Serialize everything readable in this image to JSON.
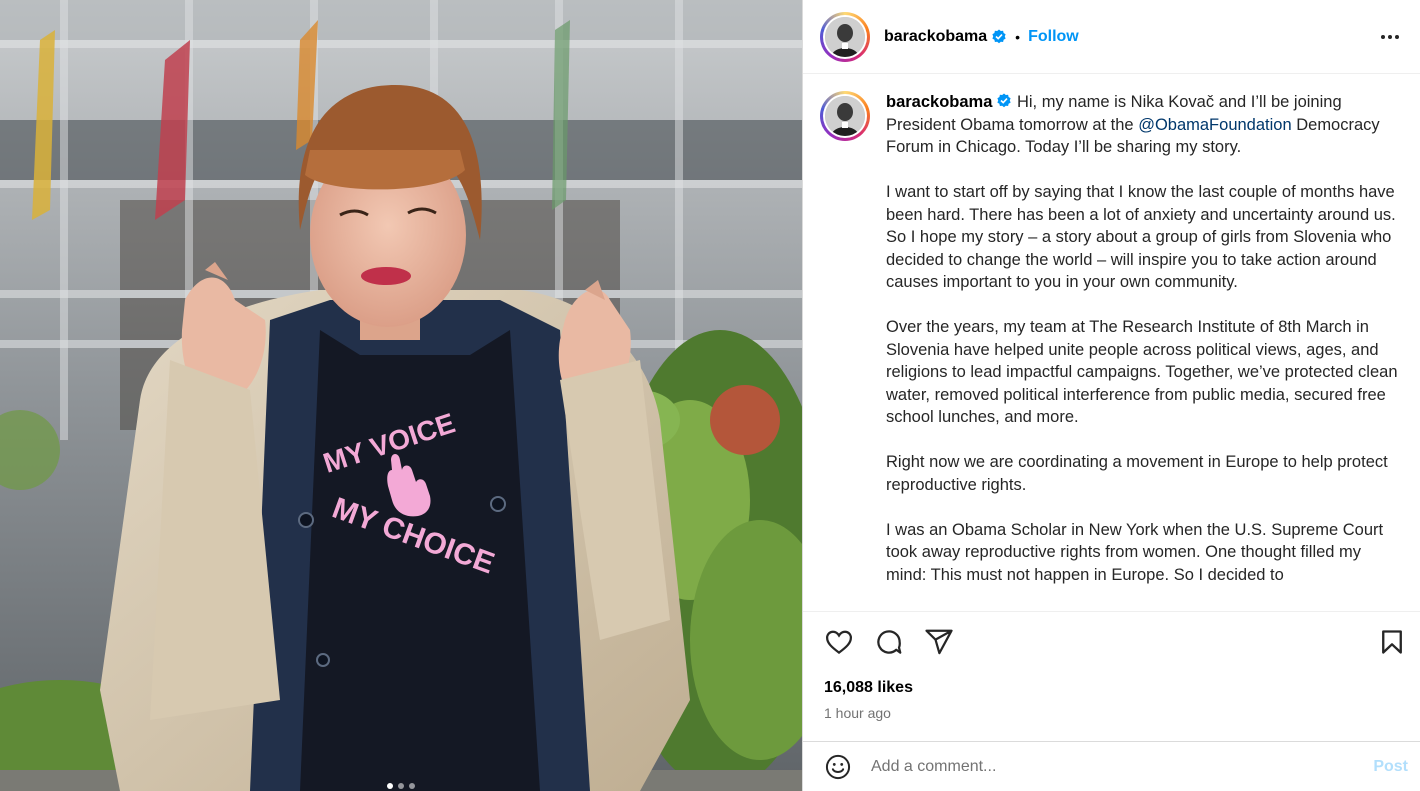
{
  "post": {
    "username": "barackobama",
    "verified": true,
    "follow_label": "Follow",
    "separator": "•",
    "more_icon": "more-options-icon",
    "caption": {
      "username": "barackobama",
      "para1_a": " Hi, my name is Nika Kovač and I’ll be joining President Obama tomorrow at the ",
      "mention": "@ObamaFoundation",
      "para1_b": " Democracy Forum in Chicago. Today I’ll be sharing my story.",
      "para2": "I want to start off by saying that I know the last couple of months have been hard. There has been a lot of anxiety and uncertainty around us. So I hope my story – a story about a group of girls from Slovenia who decided to change the world – will inspire you to take action around causes important to you in your own community.",
      "para3": "Over the years, my team at The Research Institute of 8th March in Slovenia have helped unite people across political views, ages, and religions to lead impactful campaigns. Together, we’ve protected clean water, removed political interference from public media, secured free school lunches, and more.",
      "para4": "Right now we are coordinating a movement in Europe to help protect reproductive rights.",
      "para5": "I was an Obama Scholar in New York when the U.S. Supreme Court took away reproductive rights from women. One thought filled my mind: This must not happen in Europe. So I decided to"
    },
    "likes": "16,088 likes",
    "time_ago": "1 hour ago",
    "comment_placeholder": "Add a comment...",
    "post_button": "Post",
    "image": {
      "shirt_text_top": "MY VOICE",
      "shirt_text_bottom": "MY CHOICE",
      "carousel_count": 3,
      "carousel_active": 1
    }
  },
  "icons": {
    "like": "heart-icon",
    "comment": "comment-icon",
    "share": "share-icon",
    "save": "bookmark-icon",
    "emoji": "emoji-icon"
  },
  "colors": {
    "accent": "#0095f6",
    "mention": "#00376b",
    "muted": "#737373",
    "post_disabled": "#b2dffc",
    "shirt_print": "#f3a9d6"
  }
}
